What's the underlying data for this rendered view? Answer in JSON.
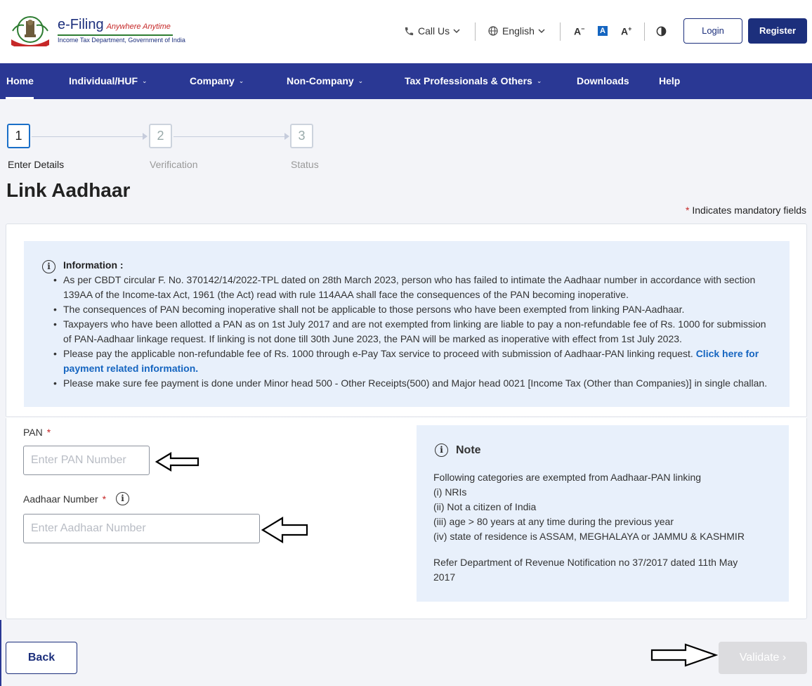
{
  "header": {
    "logo_title": "e-Filing",
    "logo_tagline": "Anywhere Anytime",
    "logo_sub": "Income Tax Department, Government of India",
    "call_us": "Call Us",
    "language": "English",
    "font_decrease": "A",
    "font_normal": "A",
    "font_increase": "A",
    "login": "Login",
    "register": "Register"
  },
  "nav": {
    "items": [
      {
        "label": "Home"
      },
      {
        "label": "Individual/HUF"
      },
      {
        "label": "Company"
      },
      {
        "label": "Non-Company"
      },
      {
        "label": "Tax Professionals & Others"
      },
      {
        "label": "Downloads"
      },
      {
        "label": "Help"
      }
    ]
  },
  "stepper": {
    "steps": [
      {
        "number": "1",
        "label": "Enter Details"
      },
      {
        "number": "2",
        "label": "Verification"
      },
      {
        "number": "3",
        "label": "Status"
      }
    ]
  },
  "page": {
    "title": "Link Aadhaar",
    "mandatory_star": "*",
    "mandatory_text": "Indicates mandatory fields"
  },
  "info": {
    "icon": "i",
    "title": "Information :",
    "items": [
      "As per CBDT circular F. No. 370142/14/2022-TPL dated on 28th March 2023, person who has failed to intimate the Aadhaar number in accordance with section 139AA of the Income-tax Act, 1961 (the Act) read with rule 114AAA shall face the consequences of the PAN becoming inoperative.",
      "The consequences of PAN becoming inoperative shall not be applicable to those persons who have been exempted from linking PAN-Aadhaar.",
      "Taxpayers who have been allotted a PAN as on 1st July 2017 and are not exempted from linking are liable to pay a non-refundable fee of Rs. 1000 for submission of PAN-Aadhaar linkage request. If linking is not done till 30th June 2023, the PAN will be marked as inoperative with effect from 1st July 2023.",
      "Please pay the applicable non-refundable fee of Rs. 1000 through e-Pay Tax service to proceed with submission of Aadhaar-PAN linking request.",
      "Please make sure fee payment is done under Minor head 500 - Other Receipts(500) and Major head 0021 [Income Tax (Other than Companies)] in single challan."
    ],
    "link_text": "Click here for payment related information."
  },
  "form": {
    "pan_label": "PAN",
    "pan_star": "*",
    "pan_placeholder": "Enter PAN Number",
    "aadhaar_label": "Aadhaar Number",
    "aadhaar_star": "*",
    "aadhaar_placeholder": "Enter Aadhaar Number"
  },
  "note": {
    "icon": "i",
    "title": "Note",
    "intro": "Following categories are exempted from Aadhaar-PAN linking",
    "items": [
      "(i) NRIs",
      "(ii) Not a citizen of India",
      "(iii) age > 80 years at any time during the previous year",
      "(iv) state of residence is ASSAM, MEGHALAYA or JAMMU & KASHMIR"
    ],
    "refer_line1": "Refer Department of Revenue Notification no 37/2017 dated 11th May",
    "refer_line2": "2017"
  },
  "actions": {
    "back": "Back",
    "validate": "Validate"
  },
  "colors": {
    "brand_navy": "#1c2f7c",
    "nav_bg": "#2a3894",
    "info_bg": "#e8f0fb",
    "link_blue": "#1565c0",
    "required_red": "#c62828",
    "disabled_button": "#dcdcdf"
  },
  "icons": [
    "emblem-logo",
    "phone-icon",
    "globe-icon",
    "chevron-down-icon",
    "contrast-icon",
    "info-icon",
    "outline-arrow-icon"
  ]
}
